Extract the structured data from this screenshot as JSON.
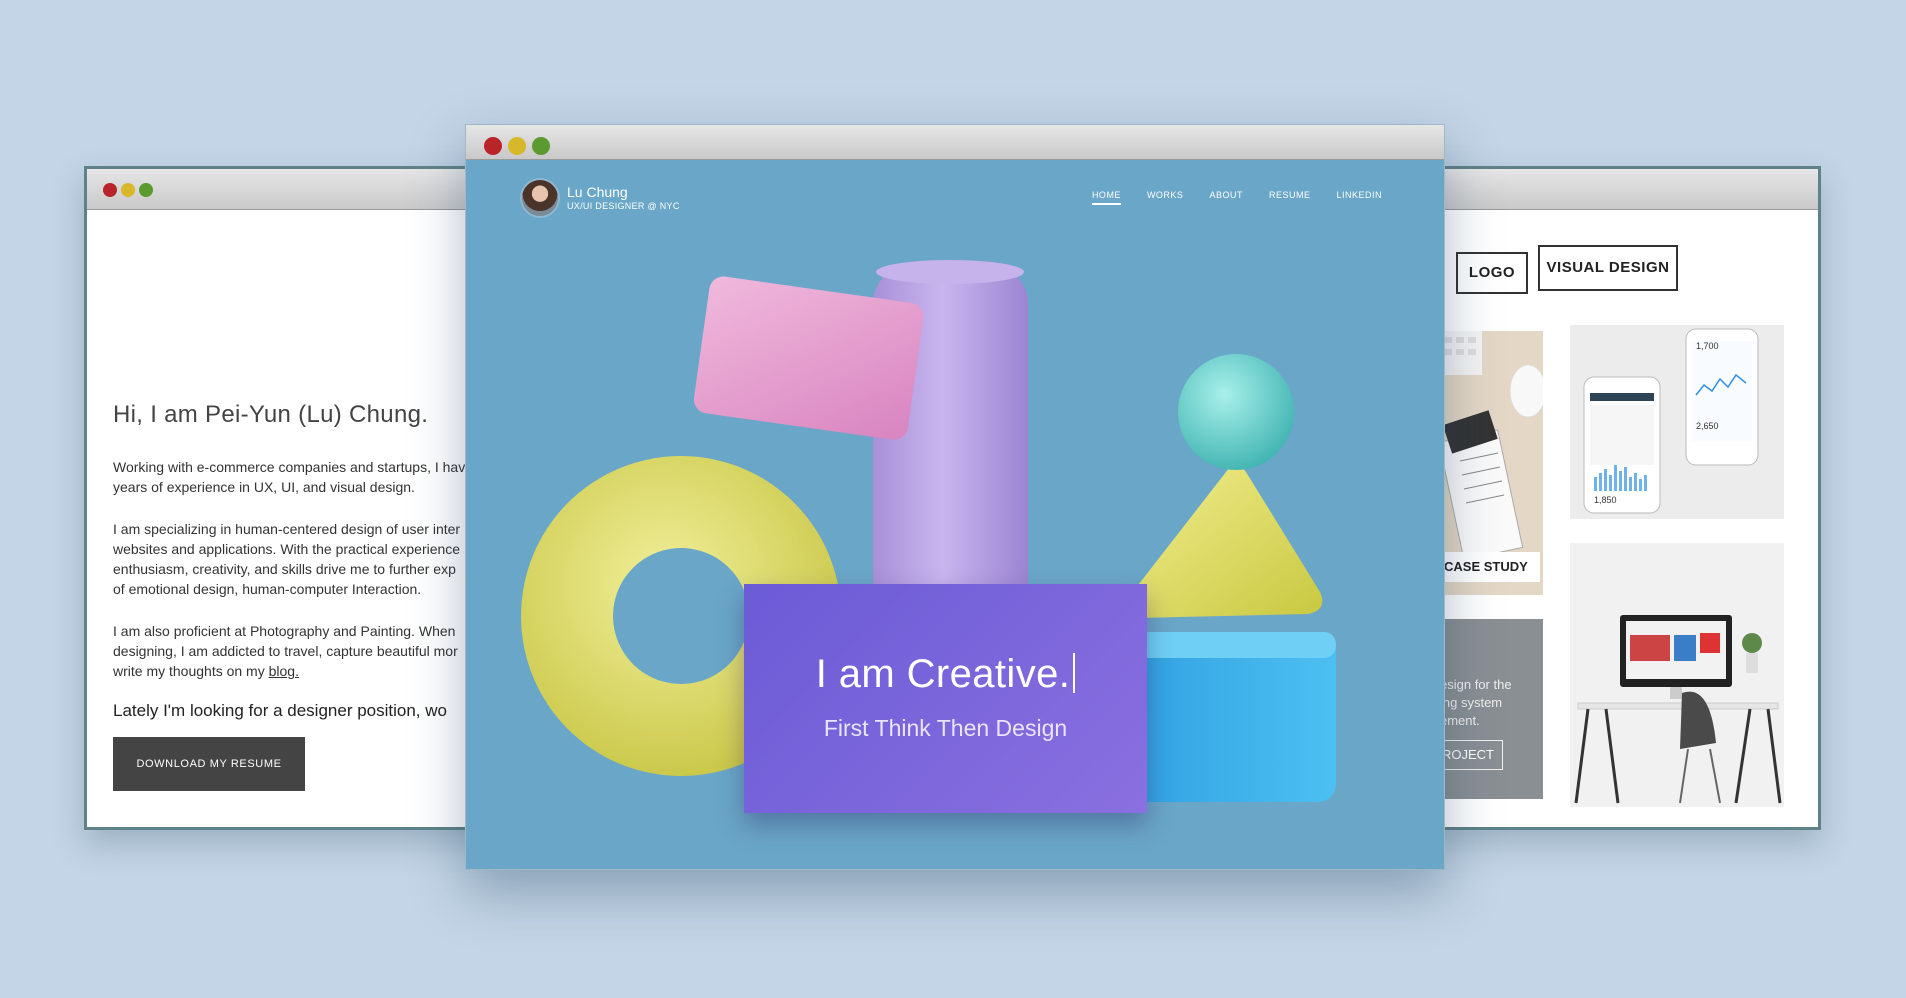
{
  "left_window": {
    "greeting": "Hi, I am Pei-Yun (Lu) Chung.",
    "paragraph1_line1": "Working with e-commerce companies and startups, I hav",
    "paragraph1_line2": "years of experience in UX, UI, and visual design.",
    "paragraph2_line1": "I am specializing in human-centered design of user inter",
    "paragraph2_line2": "websites and applications. With the practical experience",
    "paragraph2_line3": "enthusiasm, creativity, and skills drive me to further exp",
    "paragraph2_line4": "of emotional design, human-computer Interaction.",
    "paragraph3_line1": "I am also proficient at Photography and Painting. When",
    "paragraph3_line2": "designing, I am addicted to travel, capture beautiful mor",
    "paragraph3_line3_prefix": "write my thoughts on my ",
    "blog_link": "blog.",
    "lately": "Lately I'm looking for a designer position, wo",
    "download_button": "DOWNLOAD MY RESUME"
  },
  "main_window": {
    "brand_name": "Lu Chung",
    "brand_subtitle": "UX/UI DESIGNER @ NYC",
    "nav": [
      "HOME",
      "WORKS",
      "ABOUT",
      "RESUME",
      "LINKEDIN"
    ],
    "active_nav": "HOME",
    "hero_title": "I am Creative.",
    "hero_subtitle": "First Think Then Design"
  },
  "right_window": {
    "category_logo": "LOGO",
    "category_visual": "VISUAL DESIGN",
    "case_study_label": "CASE STUDY",
    "overlay_line1": "esign for the",
    "overlay_line2": "ing system",
    "overlay_line3": "ement.",
    "project_button": "ROJECT",
    "phone_stats": [
      "1,700",
      "2,650",
      "1,850"
    ]
  },
  "colors": {
    "background": "#c3d5e6",
    "hero_blue": "#6aa6c8",
    "card_purple": "#7b66dc",
    "dot_red": "#b8242a",
    "dot_yellow": "#d6b82a",
    "dot_green": "#5a9a2e"
  }
}
